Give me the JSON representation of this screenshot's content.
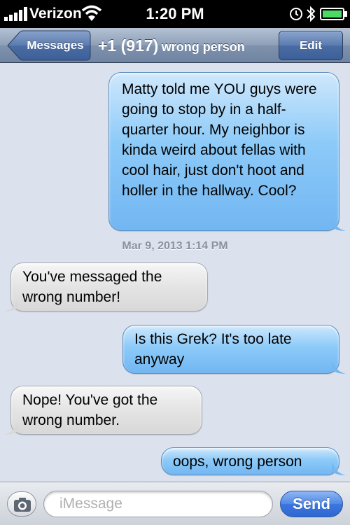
{
  "status_bar": {
    "carrier": "Verizon",
    "time": "1:20 PM",
    "icons": [
      "signal-icon",
      "wifi-icon",
      "clock-icon",
      "bluetooth-icon",
      "battery-icon"
    ]
  },
  "nav": {
    "back_label": "Messages",
    "title_number": "+1 (917)",
    "title_name": "wrong person",
    "edit_label": "Edit"
  },
  "messages": [
    {
      "direction": "outgoing",
      "text": "Matty told me YOU guys were going to stop by in a half-quarter hour. My neighbor is kinda weird about fellas with cool hair, just don't hoot and holler in the hallway. Cool?"
    },
    {
      "direction": "incoming",
      "text": "You've messaged the wrong number!"
    },
    {
      "direction": "outgoing",
      "text": "Is this Grek? It's too late anyway"
    },
    {
      "direction": "incoming",
      "text": "Nope! You've got the wrong number."
    },
    {
      "direction": "outgoing",
      "text": "oops, wrong person"
    }
  ],
  "timestamp": "Mar 9, 2013 1:14 PM",
  "input_bar": {
    "placeholder": "iMessage",
    "send_label": "Send",
    "camera_icon": "camera-icon"
  },
  "colors": {
    "outgoing_bubble": "#8ccaf8",
    "incoming_bubble": "#e4e4e4",
    "background": "#dbe2ed",
    "send_button": "#3b76de"
  }
}
